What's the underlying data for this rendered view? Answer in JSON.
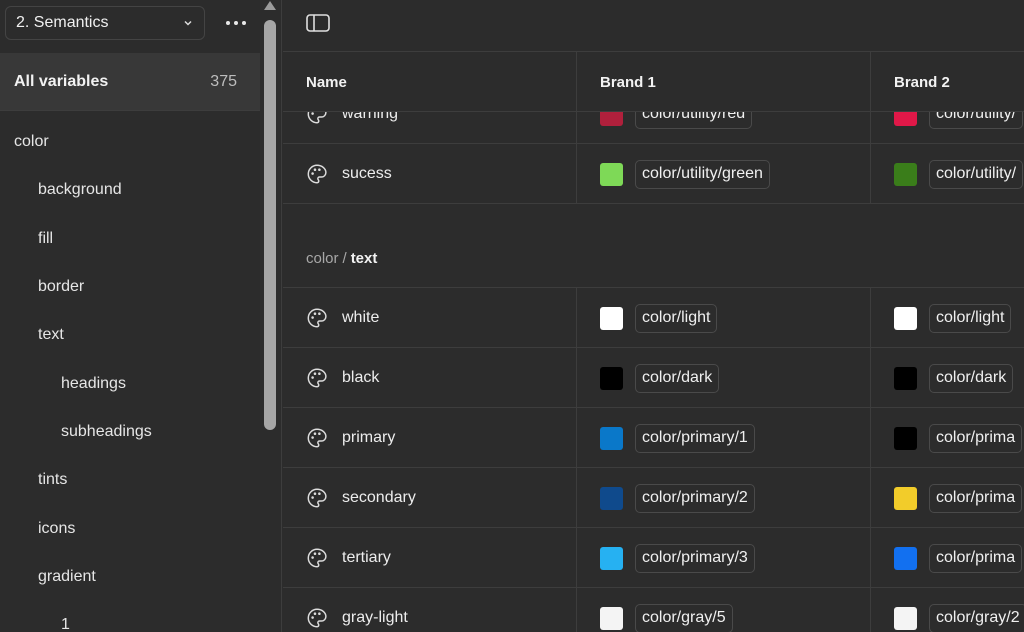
{
  "sidebar": {
    "collection": "2. Semantics",
    "all_variables_label": "All variables",
    "all_variables_count": "375",
    "tree": [
      {
        "label": "color",
        "level": 0
      },
      {
        "label": "background",
        "level": 1
      },
      {
        "label": "fill",
        "level": 1
      },
      {
        "label": "border",
        "level": 1
      },
      {
        "label": "text",
        "level": 1
      },
      {
        "label": "headings",
        "level": 2
      },
      {
        "label": "subheadings",
        "level": 2
      },
      {
        "label": "tints",
        "level": 1
      },
      {
        "label": "icons",
        "level": 1
      },
      {
        "label": "gradient",
        "level": 1
      },
      {
        "label": "1",
        "level": 2
      }
    ]
  },
  "table": {
    "columns": {
      "name": "Name",
      "brand1": "Brand 1",
      "brand2": "Brand 2"
    },
    "group_prefix": "color",
    "group_name": "text",
    "rows_top": [
      {
        "name": "warning",
        "brand1": {
          "swatch": "#b0203c",
          "value": "color/utility/red"
        },
        "brand2": {
          "swatch": "#e01848",
          "value": "color/utility/"
        }
      },
      {
        "name": "sucess",
        "brand1": {
          "swatch": "#7ed957",
          "value": "color/utility/green"
        },
        "brand2": {
          "swatch": "#3a7d1a",
          "value": "color/utility/"
        }
      }
    ],
    "rows": [
      {
        "name": "white",
        "brand1": {
          "swatch": "#ffffff",
          "value": "color/light"
        },
        "brand2": {
          "swatch": "#ffffff",
          "value": "color/light"
        }
      },
      {
        "name": "black",
        "brand1": {
          "swatch": "#000000",
          "value": "color/dark"
        },
        "brand2": {
          "swatch": "#000000",
          "value": "color/dark"
        }
      },
      {
        "name": "primary",
        "brand1": {
          "swatch": "#0a78c9",
          "value": "color/primary/1"
        },
        "brand2": {
          "swatch": "#000000",
          "value": "color/prima"
        }
      },
      {
        "name": "secondary",
        "brand1": {
          "swatch": "#0f4a8c",
          "value": "color/primary/2"
        },
        "brand2": {
          "swatch": "#f2cc2a",
          "value": "color/prima"
        }
      },
      {
        "name": "tertiary",
        "brand1": {
          "swatch": "#26b1f2",
          "value": "color/primary/3"
        },
        "brand2": {
          "swatch": "#1270f0",
          "value": "color/prima"
        }
      },
      {
        "name": "gray-light",
        "brand1": {
          "swatch": "#f4f4f4",
          "value": "color/gray/5"
        },
        "brand2": {
          "swatch": "#f4f4f4",
          "value": "color/gray/2"
        }
      }
    ]
  },
  "icons": {
    "collection_chevron": "chevron-down-icon",
    "more": "more-horizontal-icon",
    "panel_toggle": "sidebar-toggle-icon",
    "variable": "palette-icon"
  }
}
